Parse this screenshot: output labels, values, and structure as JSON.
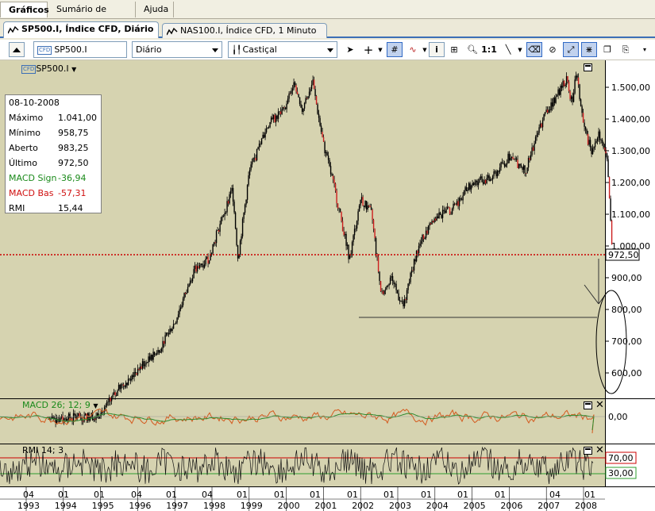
{
  "menu": {
    "tabs": [
      {
        "label": "Gráficos"
      },
      {
        "label": "Sumário de conta"
      },
      {
        "label": "Ajuda"
      }
    ]
  },
  "doc_tabs": [
    {
      "label": "SP500.I, Índice CFD, Diário",
      "active": true
    },
    {
      "label": "NAS100.I, Índice CFD, 1 Minuto",
      "active": false
    }
  ],
  "toolbar": {
    "symbol_value": "SP500.I",
    "period_value": "Diário",
    "chart_type_value": "Castiçal"
  },
  "chart_legend": {
    "instrument": "SP500.I"
  },
  "info": {
    "date": "08-10-2008",
    "rows": [
      {
        "label": "Máximo",
        "value": "1.041,00",
        "color": "#000000"
      },
      {
        "label": "Mínimo",
        "value": "958,75",
        "color": "#000000"
      },
      {
        "label": "Aberto",
        "value": "983,25",
        "color": "#000000"
      },
      {
        "label": "Último",
        "value": "972,50",
        "color": "#000000"
      },
      {
        "label": "MACD Sign",
        "value": "-36,94",
        "color": "#1a8a1a"
      },
      {
        "label": "MACD Bas",
        "value": "-57,31",
        "color": "#d01010"
      },
      {
        "label": "RMI",
        "value": "15,44",
        "color": "#000000"
      }
    ]
  },
  "price_axis": {
    "ticks": [
      "1.500,00",
      "1.400,00",
      "1.300,00",
      "1.200,00",
      "1.100,00",
      "1.000,00",
      "900,00",
      "800,00",
      "700,00",
      "600,00"
    ],
    "tick_values": [
      1500,
      1400,
      1300,
      1200,
      1100,
      1000,
      900,
      800,
      700,
      600
    ],
    "current_label": "972,50",
    "current_value": 972.5
  },
  "macd": {
    "title": "MACD 26; 12; 9",
    "axis_label": "0,00"
  },
  "rmi": {
    "title": "RMI 14; 3",
    "upper_label": "70,00",
    "lower_label": "30,00"
  },
  "time_axis": {
    "quarter_labels": [
      "04",
      "01",
      "01",
      "04",
      "01",
      "04",
      "01",
      "01",
      "01",
      "01",
      "01",
      "01",
      "01",
      "01",
      "01",
      "01",
      "04",
      "01"
    ],
    "years": [
      "1993",
      "1994",
      "1995",
      "1996",
      "1997",
      "1998",
      "1999",
      "2000",
      "2001",
      "2002",
      "2003",
      "2004",
      "2005",
      "2006",
      "2007",
      "2008"
    ]
  },
  "colors": {
    "chart_bg": "#d6d3b0",
    "candle_up": "#000000",
    "candle_down": "#cc1f1f",
    "price_line": "#cc0000",
    "macd_line": "#d45a1e",
    "macd_signal": "#2e8b2e",
    "rmi_upper": "#cc0000",
    "rmi_lower": "#2e9e2e"
  }
}
